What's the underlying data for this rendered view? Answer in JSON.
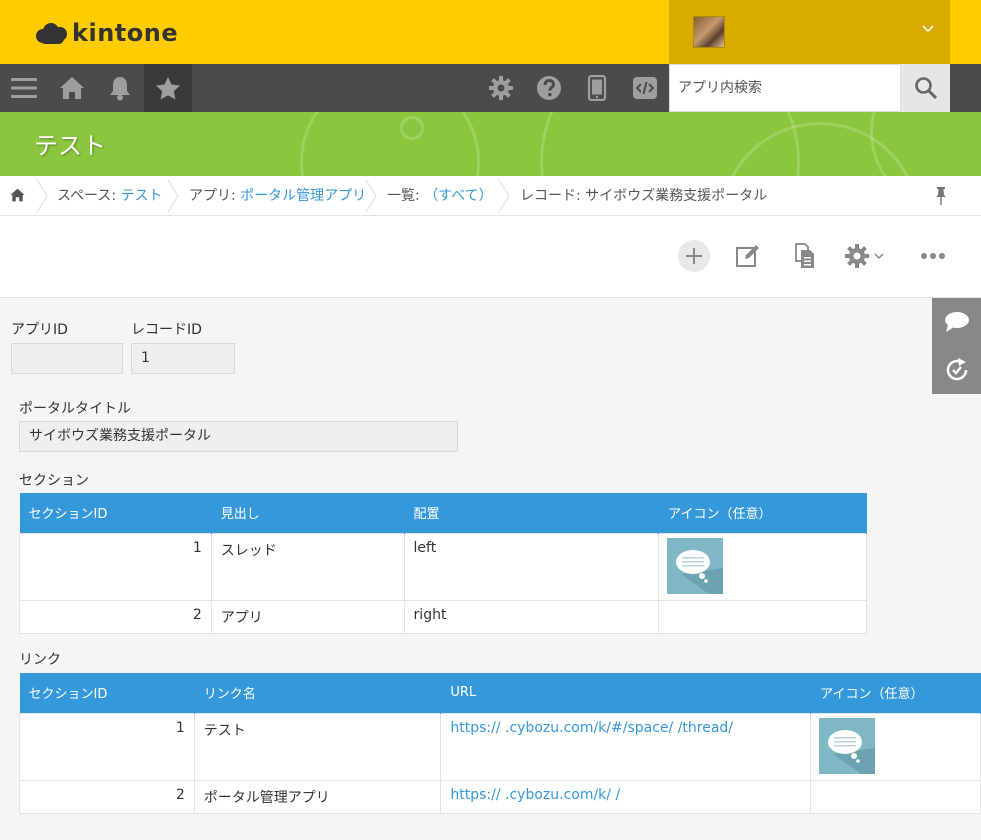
{
  "app": {
    "logo_text": "kintone",
    "brand_color": "#ffcc00",
    "nav_color": "#4b4b4b",
    "space_color": "#8cc63f",
    "accent_color": "#3498db"
  },
  "header": {
    "user_menu_icon": "chevron-down-icon"
  },
  "navbar": {
    "items": [
      "menu-icon",
      "home-icon",
      "bell-icon",
      "star-icon"
    ],
    "tools": [
      "gear-icon",
      "help-icon",
      "mobile-icon",
      "code-icon"
    ],
    "search_placeholder": "アプリ内検索"
  },
  "space": {
    "title": "テスト"
  },
  "breadcrumb": {
    "space_prefix": "スペース: ",
    "space_name": "テスト",
    "app_prefix": "アプリ: ",
    "app_name": "ポータル管理アプリ",
    "view_prefix": "一覧: ",
    "view_name": "（すべて）",
    "record_label": "レコード: サイボウズ業務支援ポータル"
  },
  "toolbar": {
    "buttons": [
      "add-icon",
      "edit-icon",
      "duplicate-icon",
      "gear-icon",
      "more-icon"
    ]
  },
  "record": {
    "app_id_label": "アプリID",
    "app_id_value": "",
    "record_id_label": "レコードID",
    "record_id_value": "1",
    "portal_title_label": "ポータルタイトル",
    "portal_title_value": "サイボウズ業務支援ポータル"
  },
  "sections": {
    "label": "セクション",
    "headers": [
      "セクションID",
      "見出し",
      "配置",
      "アイコン（任意）"
    ],
    "rows": [
      {
        "id": "1",
        "heading": "スレッド",
        "placement": "left",
        "has_icon": true
      },
      {
        "id": "2",
        "heading": "アプリ",
        "placement": "right",
        "has_icon": false
      }
    ]
  },
  "links": {
    "label": "リンク",
    "headers": [
      "セクションID",
      "リンク名",
      "URL",
      "アイコン（任意）"
    ],
    "rows": [
      {
        "id": "1",
        "name": "テスト",
        "url": "https://      .cybozu.com/k/#/space/  /thread/",
        "has_icon": true
      },
      {
        "id": "2",
        "name": "ポータル管理アプリ",
        "url": "https://      .cybozu.com/k/      /",
        "has_icon": false
      }
    ]
  }
}
